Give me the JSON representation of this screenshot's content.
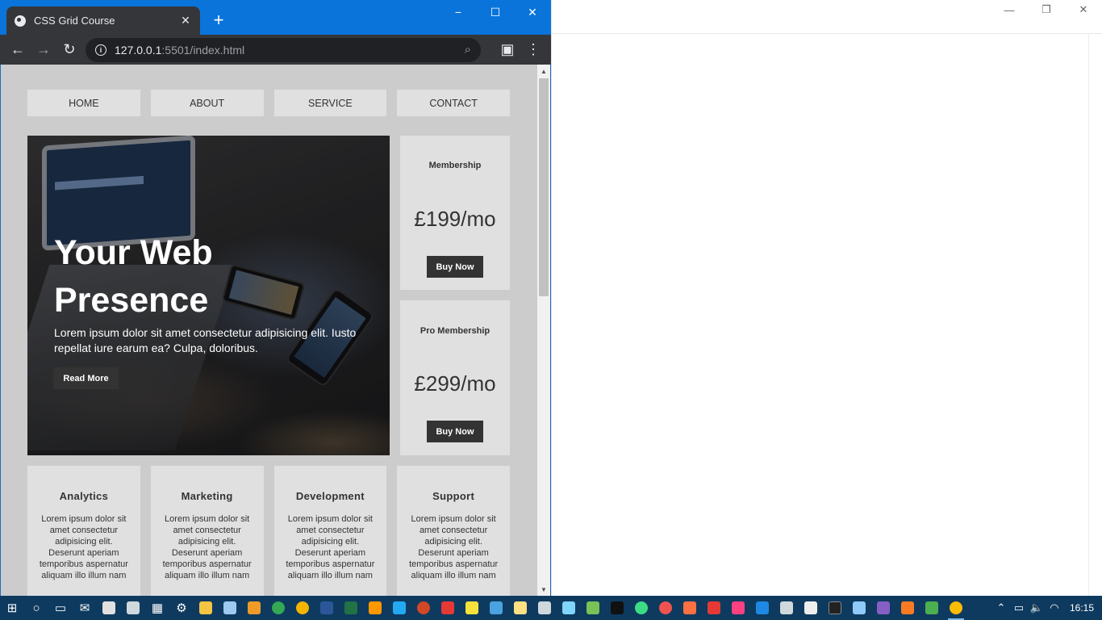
{
  "browser": {
    "tab_title": "CSS Grid Course",
    "url_host": "127.0.0.1",
    "url_path": ":5501/index.html",
    "new_tab_symbol": "+",
    "minimize_symbol": "−",
    "maximize_symbol": "☐",
    "close_symbol": "✕",
    "tab_close_symbol": "✕"
  },
  "nav": {
    "items": [
      "HOME",
      "ABOUT",
      "SERVICE",
      "CONTACT"
    ]
  },
  "hero": {
    "title": "Your Web Presence",
    "text": "Lorem ipsum dolor sit amet consectetur adipisicing elit. Iusto repellat iure earum ea? Culpa, doloribus.",
    "button": "Read More"
  },
  "pricing": [
    {
      "label": "Membership",
      "price": "£199/mo",
      "button": "Buy Now"
    },
    {
      "label": "Pro Membership",
      "price": "£299/mo",
      "button": "Buy Now"
    }
  ],
  "services": [
    {
      "title": "Analytics",
      "text": "Lorem ipsum dolor sit amet consectetur adipisicing elit. Deserunt aperiam temporibus aspernatur aliquam illo illum nam"
    },
    {
      "title": "Marketing",
      "text": "Lorem ipsum dolor sit amet consectetur adipisicing elit. Deserunt aperiam temporibus aspernatur aliquam illo illum nam"
    },
    {
      "title": "Development",
      "text": "Lorem ipsum dolor sit amet consectetur adipisicing elit. Deserunt aperiam temporibus aspernatur aliquam illo illum nam"
    },
    {
      "title": "Support",
      "text": "Lorem ipsum dolor sit amet consectetur adipisicing elit. Deserunt aperiam temporibus aspernatur aliquam illo illum nam"
    }
  ],
  "taskbar": {
    "time": "16:15",
    "apps": [
      "start-icon",
      "cortana-icon",
      "task-view-icon",
      "mail-icon",
      "photos-icon",
      "camera-icon",
      "calculator-icon",
      "settings-icon",
      "file-explorer-icon",
      "notepad-icon",
      "media-player-icon",
      "chrome-icon",
      "chrome-canary-icon",
      "word-icon",
      "excel-icon",
      "sublime-icon",
      "vscode-icon",
      "powerpoint-icon",
      "acrobat-icon",
      "sticky-notes-icon",
      "app-icon",
      "app-icon",
      "app-icon",
      "app-icon",
      "android-studio-icon",
      "intellij-icon",
      "app-icon",
      "app-icon",
      "app-icon",
      "app-icon",
      "app-icon",
      "app-icon",
      "app-icon",
      "app-icon",
      "terminal-icon",
      "app-icon",
      "visual-studio-icon",
      "xampp-icon",
      "git-icon",
      "chrome-active-icon"
    ],
    "colors": {
      "taskbar": "#0e3a5f",
      "titlebar": "#0a74da"
    }
  }
}
